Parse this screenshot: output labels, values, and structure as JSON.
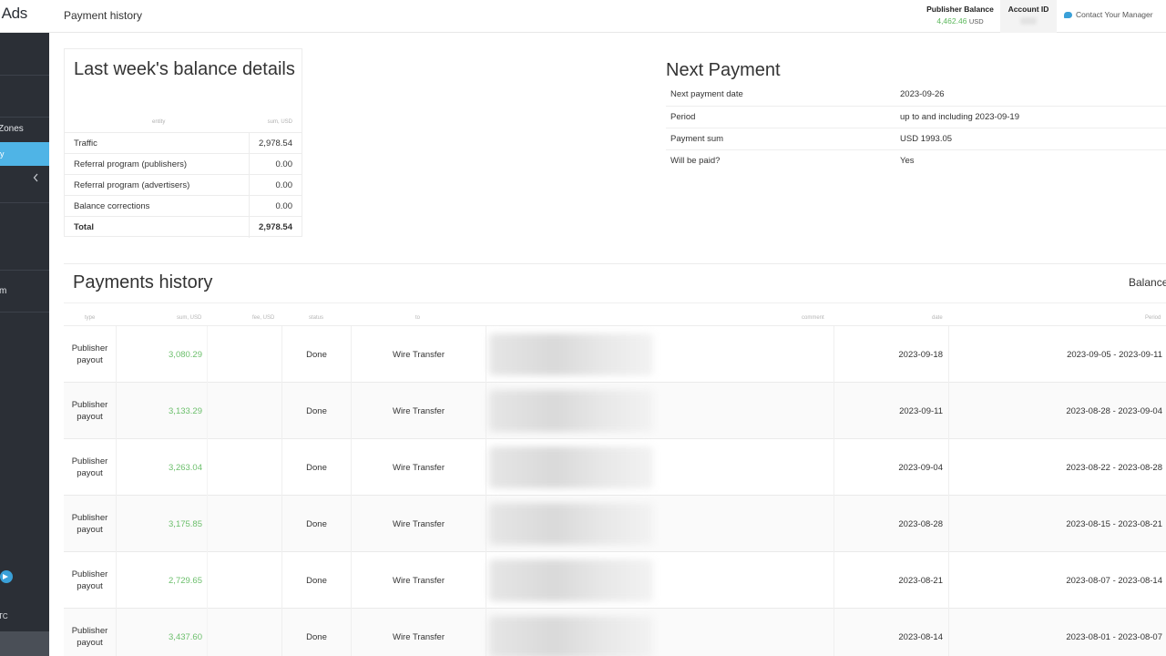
{
  "header": {
    "logo_text": "Ads",
    "page_title": "Payment history",
    "publisher_balance_label": "Publisher Balance",
    "publisher_balance_value": "4,462.46",
    "publisher_balance_currency": "USD",
    "account_id_label": "Account ID",
    "contact_label": "Contact Your Manager"
  },
  "sidebar": {
    "zones_label": "Zones",
    "active_item_label": "y",
    "program_label": "m",
    "bottom_label": "TC"
  },
  "balance_details": {
    "title": "Last week's balance details",
    "col_entity": "entity",
    "col_sum": "sum, USD",
    "rows": [
      {
        "label": "Traffic",
        "value": "2,978.54"
      },
      {
        "label": "Referral program (publishers)",
        "value": "0.00"
      },
      {
        "label": "Referral program (advertisers)",
        "value": "0.00"
      },
      {
        "label": "Balance corrections",
        "value": "0.00"
      },
      {
        "label": "Total",
        "value": "2,978.54"
      }
    ]
  },
  "next_payment": {
    "title": "Next Payment",
    "rows": [
      {
        "label": "Next payment date",
        "value": "2023-09-26"
      },
      {
        "label": "Period",
        "value": "up to and including 2023-09-19"
      },
      {
        "label": "Payment sum",
        "value": "USD 1993.05"
      },
      {
        "label": "Will be paid?",
        "value": "Yes"
      }
    ]
  },
  "payments_history": {
    "title": "Payments history",
    "balance_label": "Balance",
    "columns": [
      "type",
      "sum, USD",
      "fee, USD",
      "status",
      "to",
      "comment",
      "date",
      "Period"
    ],
    "rows": [
      {
        "type": "Publisher payout",
        "sum": "3,080.29",
        "status": "Done",
        "to": "Wire Transfer",
        "date": "2023-09-18",
        "period": "2023-09-05 - 2023-09-11"
      },
      {
        "type": "Publisher payout",
        "sum": "3,133.29",
        "status": "Done",
        "to": "Wire Transfer",
        "date": "2023-09-11",
        "period": "2023-08-28 - 2023-09-04"
      },
      {
        "type": "Publisher payout",
        "sum": "3,263.04",
        "status": "Done",
        "to": "Wire Transfer",
        "date": "2023-09-04",
        "period": "2023-08-22 - 2023-08-28"
      },
      {
        "type": "Publisher payout",
        "sum": "3,175.85",
        "status": "Done",
        "to": "Wire Transfer",
        "date": "2023-08-28",
        "period": "2023-08-15 - 2023-08-21"
      },
      {
        "type": "Publisher payout",
        "sum": "2,729.65",
        "status": "Done",
        "to": "Wire Transfer",
        "date": "2023-08-21",
        "period": "2023-08-07 - 2023-08-14"
      },
      {
        "type": "Publisher payout",
        "sum": "3,437.60",
        "status": "Done",
        "to": "Wire Transfer",
        "date": "2023-08-14",
        "period": "2023-08-01 - 2023-08-07"
      }
    ]
  },
  "colors": {
    "sidebar_bg": "#2b2f36",
    "accent": "#4fb4e6",
    "positive": "#5cb85c"
  }
}
